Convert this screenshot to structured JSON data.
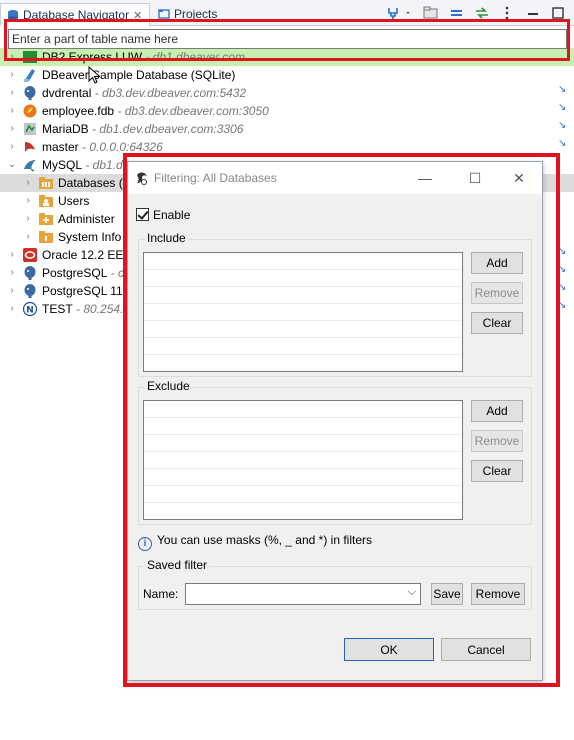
{
  "tabs": {
    "navigator_label": "Database Navigator",
    "navigator_close": "✕",
    "projects_label": "Projects"
  },
  "filter": {
    "placeholder": "Enter a part of table name here"
  },
  "tree": {
    "items": [
      {
        "label": "DB2 Express LUW",
        "host": " - db1.dbeaver.com"
      },
      {
        "label": "DBeaver Sample Database (SQLite)",
        "host": ""
      },
      {
        "label": "dvdrental",
        "host": " - db3.dev.dbeaver.com:5432"
      },
      {
        "label": "employee.fdb",
        "host": " - db3.dev.dbeaver.com:3050"
      },
      {
        "label": "MariaDB",
        "host": " - db1.dev.dbeaver.com:3306"
      },
      {
        "label": "master",
        "host": " - 0.0.0.0:64326"
      },
      {
        "label": "MySQL",
        "host": " - db1.d"
      },
      {
        "label": "Databases (…",
        "host": ""
      },
      {
        "label": "Users",
        "host": ""
      },
      {
        "label": "Administer",
        "host": ""
      },
      {
        "label": "System Info",
        "host": ""
      },
      {
        "label": "Oracle 12.2 EE",
        "host": " -"
      },
      {
        "label": "PostgreSQL",
        "host": " - c"
      },
      {
        "label": "PostgreSQL 11.",
        "host": ""
      },
      {
        "label": "TEST",
        "host": " - 80.254.5"
      }
    ]
  },
  "dialog": {
    "title": "Filtering: All Databases",
    "minimize": "—",
    "maximize": "☐",
    "close": "✕",
    "enable_label": "Enable",
    "include_label": "Include",
    "exclude_label": "Exclude",
    "add_label": "Add",
    "remove_label": "Remove",
    "clear_label": "Clear",
    "info_text": "You can use masks (%, _ and *) in filters",
    "saved_filter_label": "Saved filter",
    "name_label": "Name:",
    "name_value": "",
    "save_label": "Save",
    "remove_saved_label": "Remove",
    "ok_label": "OK",
    "cancel_label": "Cancel"
  },
  "colors": {
    "highlight_red": "#e0141e",
    "selection": "#dcdcdc",
    "info_blue": "#2565c4"
  }
}
